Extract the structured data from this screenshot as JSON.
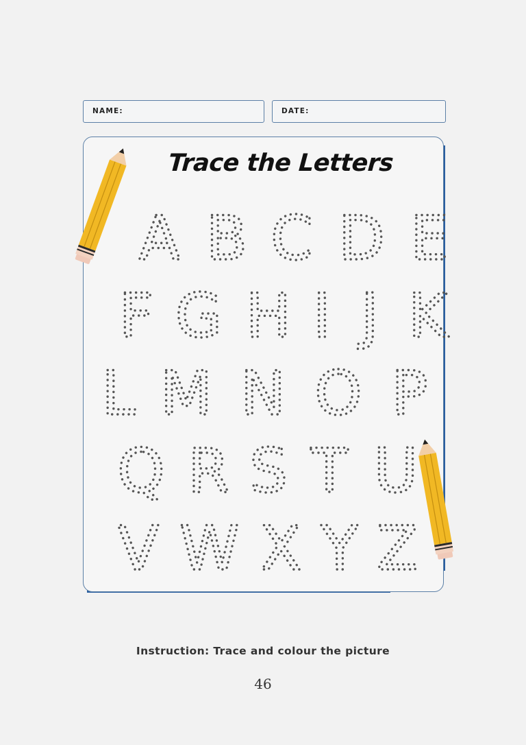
{
  "header": {
    "name_label": "NAME:",
    "date_label": "DATE:"
  },
  "worksheet": {
    "title": "Trace the Letters",
    "letter_rows": [
      [
        "A",
        "B",
        "C",
        "D",
        "E"
      ],
      [
        "F",
        "G",
        "H",
        "I",
        "J",
        "K"
      ],
      [
        "L",
        "M",
        "N",
        "O",
        "P"
      ],
      [
        "Q",
        "R",
        "S",
        "T",
        "U"
      ],
      [
        "V",
        "W",
        "X",
        "Y",
        "Z"
      ]
    ]
  },
  "footer": {
    "instruction": "Instruction: Trace and colour the picture",
    "page_number": "46"
  },
  "colors": {
    "frame_accent": "#2a5fa0",
    "pencil_body": "#f1b824",
    "tracing_dots": "#555555"
  },
  "decorations": [
    "pencil-icon",
    "pencil-icon"
  ]
}
